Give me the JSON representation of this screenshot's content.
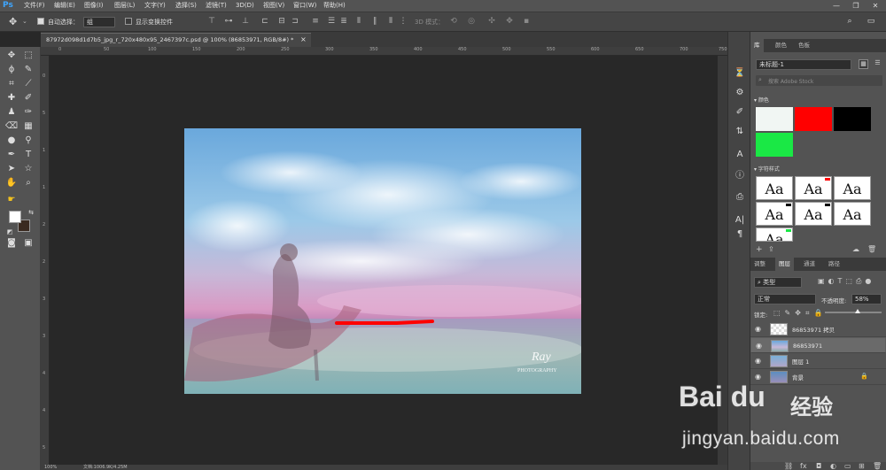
{
  "app": {
    "logo": "Ps"
  },
  "menu": [
    "文件(F)",
    "编辑(E)",
    "图像(I)",
    "图层(L)",
    "文字(Y)",
    "选择(S)",
    "滤镜(T)",
    "3D(D)",
    "视图(V)",
    "窗口(W)",
    "帮助(H)"
  ],
  "window_controls": {
    "minimize": "—",
    "maximize": "❐",
    "close": "✕"
  },
  "options": {
    "auto_select_label": "自动选择：",
    "auto_select_value": "组",
    "show_transform_label": "显示变换控件",
    "mode_3d_label": "3D 模式："
  },
  "document": {
    "tab_title": "87972d098d1d7b5_jpg_r_720x480x95_2467397c.psd @ 100% (86853971, RGB/8#) *",
    "close_glyph": "×",
    "zoom": "100%",
    "doc_size": "文档:1006.9K/4.25M",
    "photo_signature": "Ray",
    "photo_signature_sub": "PHOTOGRAPHY"
  },
  "ruler_top": [
    "0",
    "50",
    "100",
    "150",
    "200",
    "250",
    "300",
    "350",
    "400",
    "450",
    "500",
    "550",
    "600",
    "650",
    "700",
    "750"
  ],
  "ruler_left": [
    "0",
    "5",
    "1",
    "1",
    "2",
    "2",
    "3",
    "3",
    "4",
    "4",
    "5"
  ],
  "library_panel": {
    "tabs": [
      "库",
      "颜色",
      "色板"
    ],
    "library_name": "未标题-1",
    "search_placeholder": "搜索 Adobe Stock",
    "colors_title": "颜色",
    "colors": [
      "#f1f6f3",
      "#ff0000",
      "#000000",
      "#1ae845"
    ],
    "char_styles_title": "字符样式",
    "char_style_sample": "Aa"
  },
  "layers_panel": {
    "tabs": [
      "调整",
      "图层",
      "通道",
      "路径"
    ],
    "filter_label": "类型",
    "blend_mode": "正常",
    "opacity_label": "不透明度:",
    "opacity_value": "58%",
    "lock_label": "锁定:",
    "fill_label": "填充:",
    "layers": [
      {
        "name": "86853971 拷贝",
        "selected": false
      },
      {
        "name": "86853971",
        "selected": true
      },
      {
        "name": "图层 1",
        "selected": false
      },
      {
        "name": "背景",
        "selected": false
      }
    ]
  },
  "watermark": {
    "logo": "Bai du",
    "cn": "经验",
    "url": "jingyan.baidu.com"
  }
}
